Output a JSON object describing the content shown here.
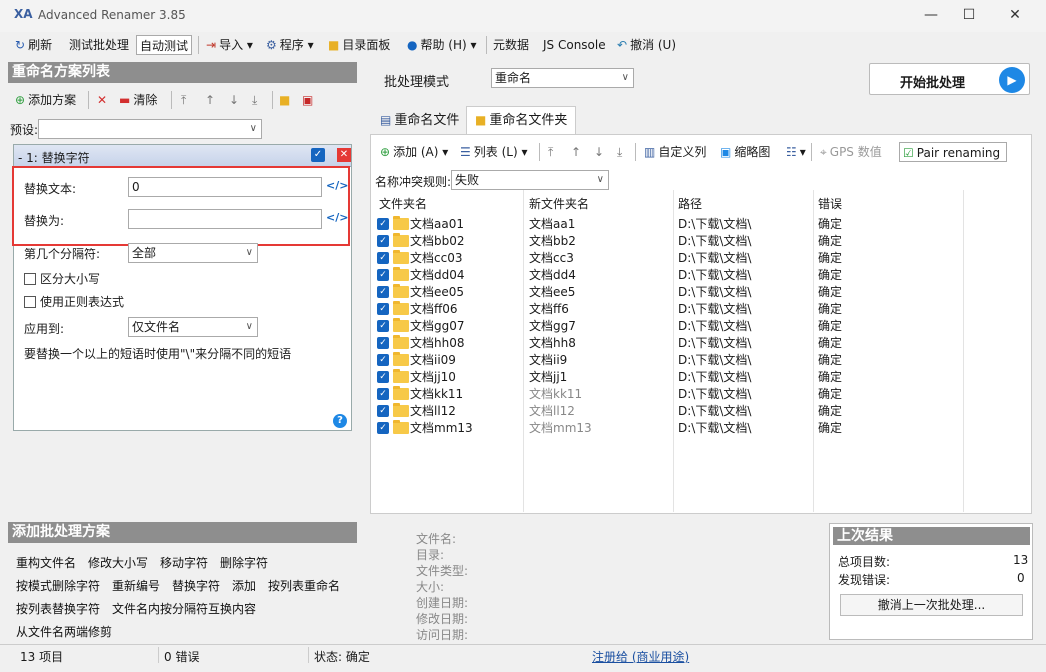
{
  "app": {
    "title": "Advanced Renamer 3.85",
    "logo": "XA"
  },
  "window_controls": {
    "minimize": "—",
    "maximize": "☐",
    "close": "✕"
  },
  "toolbar": {
    "refresh": "刷新",
    "test_batch": "测试批处理",
    "auto_test": "自动测试",
    "import": "导入",
    "program": "程序",
    "dir_panel": "目录面板",
    "help": "帮助 (H)",
    "metadata": "元数据",
    "js_console": "JS Console",
    "undo": "撤消 (U)"
  },
  "left": {
    "panel_title": "重命名方案列表",
    "add_method": "添加方案",
    "clear": "清除",
    "preset_label": "预设:",
    "method": {
      "title": "- 1: 替换字符",
      "replace_text_label": "替换文本:",
      "replace_text_value": "0",
      "replace_with_label": "替换为:",
      "replace_with_value": "",
      "nth_label": "第几个分隔符:",
      "nth_value": "全部",
      "case_sensitive": "区分大小写",
      "use_regex": "使用正则表达式",
      "apply_to_label": "应用到:",
      "apply_to_value": "仅文件名",
      "hint": "要替换一个以上的短语时使用\"\\\"来分隔不同的短语"
    },
    "add_batch_title": "添加批处理方案",
    "methods_row1": [
      "重构文件名",
      "修改大小写",
      "移动字符",
      "删除字符"
    ],
    "methods_row2": [
      "按模式删除字符",
      "重新编号",
      "替换字符",
      "添加",
      "按列表重命名"
    ],
    "methods_row3": [
      "按列表替换字符",
      "文件名内按分隔符互换内容"
    ],
    "methods_row4": [
      "从文件名两端修剪"
    ]
  },
  "right": {
    "batch_mode_label": "批处理模式",
    "batch_mode_value": "重命名",
    "start_button": "开始批处理",
    "tabs": [
      "重命名文件",
      "重命名文件夹"
    ],
    "grid_toolbar": {
      "add": "添加 (A)",
      "list": "列表 (L)",
      "custom_columns": "自定义列",
      "thumbnails": "缩略图",
      "gps": "GPS 数值",
      "pair": "Pair renaming"
    },
    "conflict_label": "名称冲突规则:",
    "conflict_value": "失败",
    "columns": [
      "文件夹名",
      "新文件夹名",
      "路径",
      "错误"
    ],
    "rows": [
      {
        "name": "文档aa01",
        "new": "文档aa1",
        "path": "D:\\下载\\文档\\",
        "status": "确定",
        "grey": false
      },
      {
        "name": "文档bb02",
        "new": "文档bb2",
        "path": "D:\\下载\\文档\\",
        "status": "确定",
        "grey": false
      },
      {
        "name": "文档cc03",
        "new": "文档cc3",
        "path": "D:\\下载\\文档\\",
        "status": "确定",
        "grey": false
      },
      {
        "name": "文档dd04",
        "new": "文档dd4",
        "path": "D:\\下载\\文档\\",
        "status": "确定",
        "grey": false
      },
      {
        "name": "文档ee05",
        "new": "文档ee5",
        "path": "D:\\下载\\文档\\",
        "status": "确定",
        "grey": false
      },
      {
        "name": "文档ff06",
        "new": "文档ff6",
        "path": "D:\\下载\\文档\\",
        "status": "确定",
        "grey": false
      },
      {
        "name": "文档gg07",
        "new": "文档gg7",
        "path": "D:\\下载\\文档\\",
        "status": "确定",
        "grey": false
      },
      {
        "name": "文档hh08",
        "new": "文档hh8",
        "path": "D:\\下载\\文档\\",
        "status": "确定",
        "grey": false
      },
      {
        "name": "文档ii09",
        "new": "文档ii9",
        "path": "D:\\下载\\文档\\",
        "status": "确定",
        "grey": false
      },
      {
        "name": "文档jj10",
        "new": "文档jj1",
        "path": "D:\\下载\\文档\\",
        "status": "确定",
        "grey": false
      },
      {
        "name": "文档kk11",
        "new": "文档kk11",
        "path": "D:\\下载\\文档\\",
        "status": "确定",
        "grey": true
      },
      {
        "name": "文档ll12",
        "new": "文档ll12",
        "path": "D:\\下载\\文档\\",
        "status": "确定",
        "grey": true
      },
      {
        "name": "文档mm13",
        "new": "文档mm13",
        "path": "D:\\下载\\文档\\",
        "status": "确定",
        "grey": true
      }
    ],
    "info_labels": [
      "文件名:",
      "目录:",
      "文件类型:",
      "大小:",
      "创建日期:",
      "修改日期:",
      "访问日期:"
    ],
    "results": {
      "title": "上次结果",
      "total_label": "总项目数:",
      "total_value": "13",
      "errors_label": "发现错误:",
      "errors_value": "0",
      "undo_button": "撤消上一次批处理..."
    }
  },
  "status": {
    "items": "13 项目",
    "errors": "0 错误",
    "state": "状态: 确定",
    "register": "注册给 (商业用途)"
  }
}
